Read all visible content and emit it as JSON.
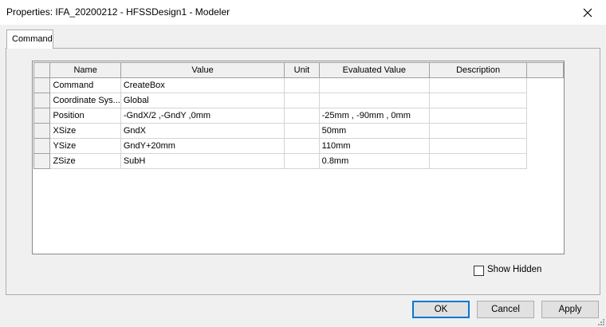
{
  "window": {
    "title": "Properties: IFA_20200212 - HFSSDesign1 - Modeler"
  },
  "tabs": [
    {
      "label": "Command"
    }
  ],
  "table": {
    "columns": [
      "Name",
      "Value",
      "Unit",
      "Evaluated Value",
      "Description"
    ],
    "rows": [
      {
        "name": "Command",
        "value": "CreateBox",
        "unit": "",
        "evaluated": "",
        "description": ""
      },
      {
        "name": "Coordinate Sys...",
        "value": "Global",
        "unit": "",
        "evaluated": "",
        "description": ""
      },
      {
        "name": "Position",
        "value": "-GndX/2 ,-GndY ,0mm",
        "unit": "",
        "evaluated": "-25mm , -90mm , 0mm",
        "description": ""
      },
      {
        "name": "XSize",
        "value": "GndX",
        "unit": "",
        "evaluated": "50mm",
        "description": ""
      },
      {
        "name": "YSize",
        "value": "GndY+20mm",
        "unit": "",
        "evaluated": "110mm",
        "description": ""
      },
      {
        "name": "ZSize",
        "value": "SubH",
        "unit": "",
        "evaluated": "0.8mm",
        "description": ""
      }
    ]
  },
  "show_hidden": {
    "label": "Show Hidden",
    "checked": false
  },
  "buttons": {
    "ok": "OK",
    "cancel": "Cancel",
    "apply": "Apply"
  }
}
